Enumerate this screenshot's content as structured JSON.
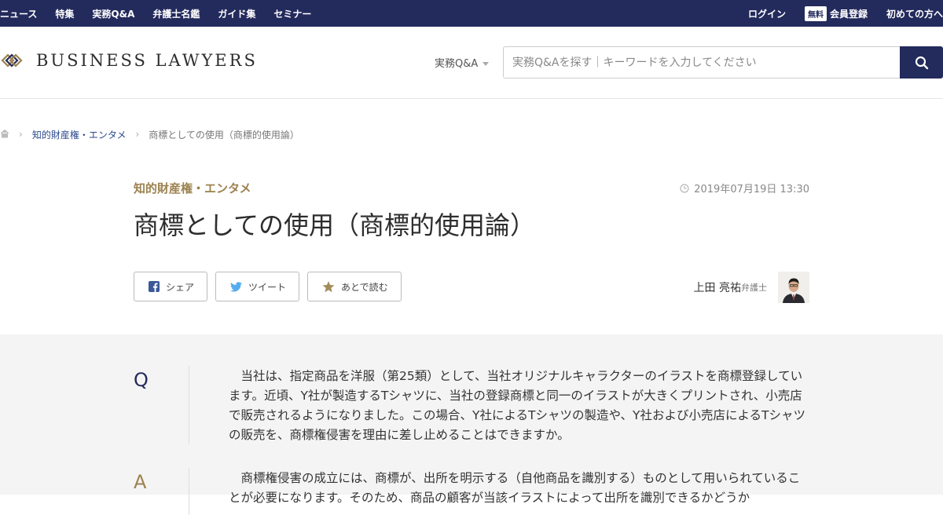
{
  "topnav": {
    "left": [
      "ニュース",
      "特集",
      "実務Q&A",
      "弁護士名鑑",
      "ガイド集",
      "セミナー"
    ],
    "login": "ログイン",
    "free_badge": "無料",
    "register": "会員登録",
    "first_time": "初めての方へ"
  },
  "header": {
    "logo_text": "BUSINESS LAWYERS",
    "search_type": "実務Q&A",
    "search_placeholder": "実務Q&Aを探す｜キーワードを入力してください"
  },
  "breadcrumb": {
    "category": "知的財産権・エンタメ",
    "current": "商標としての使用（商標的使用論）"
  },
  "article": {
    "category": "知的財産権・エンタメ",
    "date": "2019年07月19日 13:30",
    "title": "商標としての使用（商標的使用論）",
    "share_label": "シェア",
    "tweet_label": "ツイート",
    "later_label": "あとで読む",
    "author_name": "上田 亮祐",
    "author_role": "弁護士"
  },
  "qa": {
    "q_letter": "Q",
    "question": "当社は、指定商品を洋服（第25類）として、当社オリジナルキャラクターのイラストを商標登録しています。近頃、Y社が製造するTシャツに、当社の登録商標と同一のイラストが大きくプリントされ、小売店で販売されるようになりました。この場合、Y社によるTシャツの製造や、Y社および小売店によるTシャツの販売を、商標権侵害を理由に差し止めることはできますか。",
    "a_letter": "A",
    "answer": "商標権侵害の成立には、商標が、出所を明示する（自他商品を識別する）ものとして用いられていることが必要になります。そのため、商品の顧客が当該イラストによって出所を識別できるかどうか"
  },
  "colors": {
    "navy": "#232a5c",
    "gold": "#9c8250",
    "link": "#2b4a8c"
  }
}
